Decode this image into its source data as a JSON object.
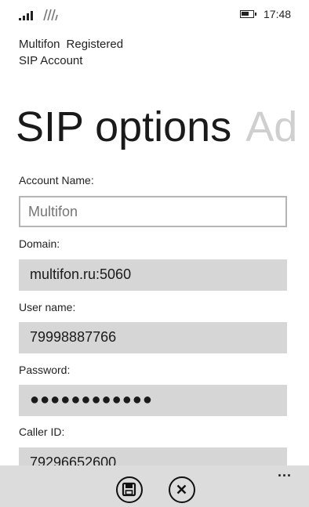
{
  "status_bar": {
    "time": "17:48"
  },
  "header": {
    "account": "Multifon",
    "state": "Registered",
    "subtitle": "SIP Account"
  },
  "pivot": {
    "active": "SIP options",
    "next": "Ad"
  },
  "form": {
    "account_name": {
      "label": "Account Name:",
      "placeholder": "Multifon",
      "value": ""
    },
    "domain": {
      "label": "Domain:",
      "value": "multifon.ru:5060"
    },
    "user_name": {
      "label": "User name:",
      "value": "79998887766"
    },
    "password": {
      "label": "Password:",
      "value": "●●●●●●●●●●●●"
    },
    "caller_id": {
      "label": "Caller ID:",
      "value": "79296652600"
    }
  },
  "app_bar": {
    "more": "..."
  },
  "icons": [
    "signal-icon",
    "wifi-icon",
    "battery-icon",
    "save-icon",
    "cancel-icon",
    "more-icon"
  ]
}
